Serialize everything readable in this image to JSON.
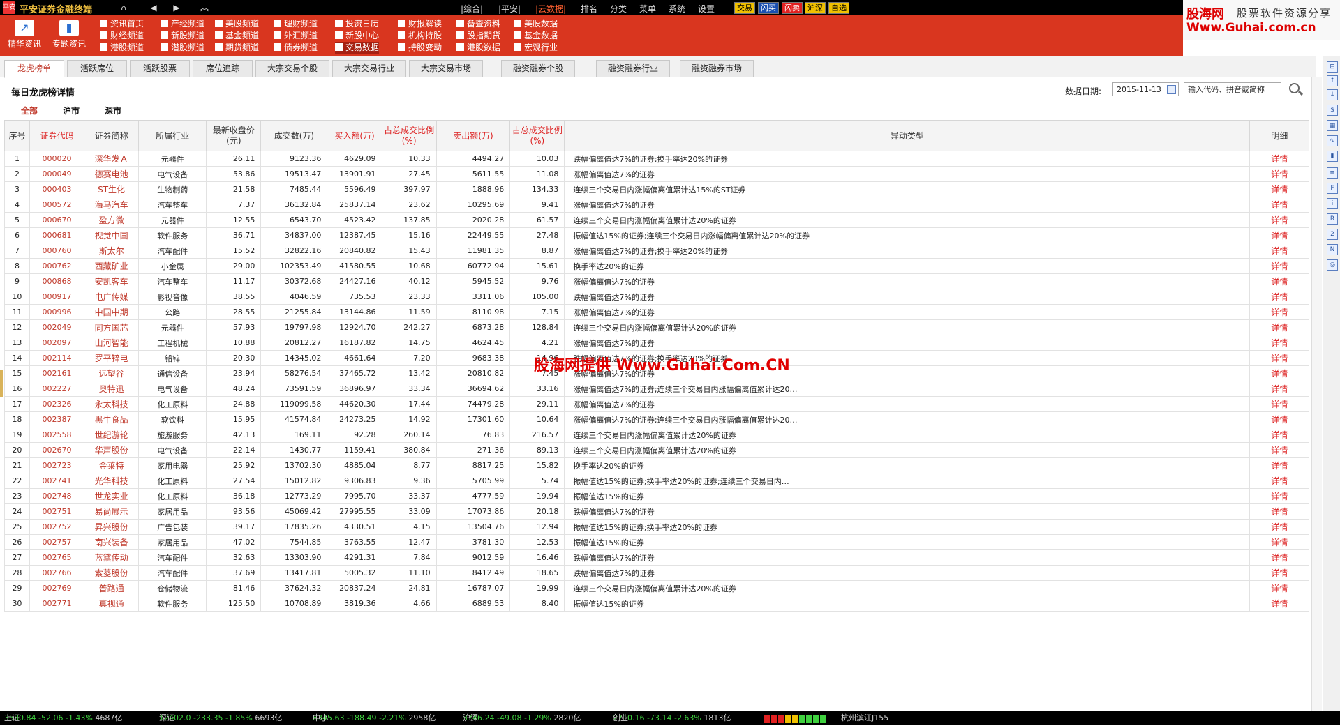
{
  "app": {
    "title": "平安证券金融终端",
    "logo_text": "平安"
  },
  "topbar": {
    "menus": [
      "|综合|",
      "|平安|",
      "|云数据|",
      "排名",
      "分类",
      "菜单",
      "系统",
      "设置"
    ],
    "active_menu": "|云数据|",
    "pills": [
      "交易",
      "闪买",
      "闪卖",
      "沪深",
      "自选"
    ]
  },
  "brand": {
    "line1": "股海网",
    "line2": "股票软件资源分享",
    "line3": "Www.Guhai.com.cn"
  },
  "ribbon": {
    "big_buttons": [
      {
        "label": "精华资讯",
        "icon": "chart-icon"
      },
      {
        "label": "专题资讯",
        "icon": "bar-chart-icon"
      }
    ],
    "columns": [
      [
        "资讯首页",
        "财经频道",
        "港股频道"
      ],
      [
        "产经频道",
        "新股频道",
        "潜股频道"
      ],
      [
        "美股频道",
        "基金频道",
        "期货频道"
      ],
      [
        "理财频道",
        "外汇频道",
        "债券频道"
      ],
      [
        "投资日历",
        "新股中心",
        "交易数据"
      ],
      [
        "财报解读",
        "机构持股",
        "持股变动"
      ],
      [
        "备查资料",
        "股指期货",
        "港股数据"
      ],
      [
        "美股数据",
        "基金数据",
        "宏观行业"
      ]
    ],
    "selected_item": "交易数据"
  },
  "tabs": [
    "龙虎榜单",
    "活跃席位",
    "活跃股票",
    "席位追踪",
    "大宗交易个股",
    "大宗交易行业",
    "大宗交易市场",
    "融资融券个股",
    "融资融券行业",
    "融资融券市场"
  ],
  "active_tab": "龙虎榜单",
  "page": {
    "title": "每日龙虎榜详情",
    "date_label": "数据日期:",
    "date_value": "2015-11-13",
    "search_placeholder": "输入代码、拼音或简称",
    "markets": [
      "全部",
      "沪市",
      "深市"
    ],
    "active_market": "全部"
  },
  "table": {
    "headers": [
      "序号",
      "证券代码",
      "证券简称",
      "所属行业",
      "最新收盘价(元)",
      "成交数(万)",
      "买入额(万)",
      "占总成交比例(%)",
      "卖出额(万)",
      "占总成交比例(%)",
      "异动类型",
      "明细"
    ],
    "red_headers": [
      1,
      6,
      7,
      8,
      9
    ],
    "detail_label": "详情",
    "rows": [
      [
        "1",
        "000020",
        "深华发Ａ",
        "元器件",
        "26.11",
        "9123.36",
        "4629.09",
        "10.33",
        "4494.27",
        "10.03",
        "跌幅偏离值达7%的证券;换手率达20%的证券"
      ],
      [
        "2",
        "000049",
        "德赛电池",
        "电气设备",
        "53.86",
        "19513.47",
        "13901.91",
        "27.45",
        "5611.55",
        "11.08",
        "涨幅偏离值达7%的证券"
      ],
      [
        "3",
        "000403",
        "ST生化",
        "生物制药",
        "21.58",
        "7485.44",
        "5596.49",
        "397.97",
        "1888.96",
        "134.33",
        "连续三个交易日内涨幅偏离值累计达15%的ST证券"
      ],
      [
        "4",
        "000572",
        "海马汽车",
        "汽车整车",
        "7.37",
        "36132.84",
        "25837.14",
        "23.62",
        "10295.69",
        "9.41",
        "涨幅偏离值达7%的证券"
      ],
      [
        "5",
        "000670",
        "盈方微",
        "元器件",
        "12.55",
        "6543.70",
        "4523.42",
        "137.85",
        "2020.28",
        "61.57",
        "连续三个交易日内涨幅偏离值累计达20%的证券"
      ],
      [
        "6",
        "000681",
        "视觉中国",
        "软件服务",
        "36.71",
        "34837.00",
        "12387.45",
        "15.16",
        "22449.55",
        "27.48",
        "振幅值达15%的证券;连续三个交易日内涨幅偏离值累计达20%的证券"
      ],
      [
        "7",
        "000760",
        "斯太尔",
        "汽车配件",
        "15.52",
        "32822.16",
        "20840.82",
        "15.43",
        "11981.35",
        "8.87",
        "涨幅偏离值达7%的证券;换手率达20%的证券"
      ],
      [
        "8",
        "000762",
        "西藏矿业",
        "小金属",
        "29.00",
        "102353.49",
        "41580.55",
        "10.68",
        "60772.94",
        "15.61",
        "换手率达20%的证券"
      ],
      [
        "9",
        "000868",
        "安凯客车",
        "汽车整车",
        "11.17",
        "30372.68",
        "24427.16",
        "40.12",
        "5945.52",
        "9.76",
        "涨幅偏离值达7%的证券"
      ],
      [
        "10",
        "000917",
        "电广传媒",
        "影视音像",
        "38.55",
        "4046.59",
        "735.53",
        "23.33",
        "3311.06",
        "105.00",
        "跌幅偏离值达7%的证券"
      ],
      [
        "11",
        "000996",
        "中国中期",
        "公路",
        "28.55",
        "21255.84",
        "13144.86",
        "11.59",
        "8110.98",
        "7.15",
        "涨幅偏离值达7%的证券"
      ],
      [
        "12",
        "002049",
        "同方国芯",
        "元器件",
        "57.93",
        "19797.98",
        "12924.70",
        "242.27",
        "6873.28",
        "128.84",
        "连续三个交易日内涨幅偏离值累计达20%的证券"
      ],
      [
        "13",
        "002097",
        "山河智能",
        "工程机械",
        "10.88",
        "20812.27",
        "16187.82",
        "14.75",
        "4624.45",
        "4.21",
        "涨幅偏离值达7%的证券"
      ],
      [
        "14",
        "002114",
        "罗平锌电",
        "铅锌",
        "20.30",
        "14345.02",
        "4661.64",
        "7.20",
        "9683.38",
        "14.96",
        "跌幅偏离值达7%的证券;换手率达20%的证券"
      ],
      [
        "15",
        "002161",
        "远望谷",
        "通信设备",
        "23.94",
        "58276.54",
        "37465.72",
        "13.42",
        "20810.82",
        "7.45",
        "涨幅偏离值达7%的证券"
      ],
      [
        "16",
        "002227",
        "奥特迅",
        "电气设备",
        "48.24",
        "73591.59",
        "36896.97",
        "33.34",
        "36694.62",
        "33.16",
        "涨幅偏离值达7%的证券;连续三个交易日内涨幅偏离值累计达20…"
      ],
      [
        "17",
        "002326",
        "永太科技",
        "化工原料",
        "24.88",
        "119099.58",
        "44620.30",
        "17.44",
        "74479.28",
        "29.11",
        "涨幅偏离值达7%的证券"
      ],
      [
        "18",
        "002387",
        "黑牛食品",
        "软饮料",
        "15.95",
        "41574.84",
        "24273.25",
        "14.92",
        "17301.60",
        "10.64",
        "涨幅偏离值达7%的证券;连续三个交易日内涨幅偏离值累计达20…"
      ],
      [
        "19",
        "002558",
        "世纪游轮",
        "旅游服务",
        "42.13",
        "169.11",
        "92.28",
        "260.14",
        "76.83",
        "216.57",
        "连续三个交易日内涨幅偏离值累计达20%的证券"
      ],
      [
        "20",
        "002670",
        "华声股份",
        "电气设备",
        "22.14",
        "1430.77",
        "1159.41",
        "380.84",
        "271.36",
        "89.13",
        "连续三个交易日内涨幅偏离值累计达20%的证券"
      ],
      [
        "21",
        "002723",
        "金莱特",
        "家用电器",
        "25.92",
        "13702.30",
        "4885.04",
        "8.77",
        "8817.25",
        "15.82",
        "换手率达20%的证券"
      ],
      [
        "22",
        "002741",
        "光华科技",
        "化工原料",
        "27.54",
        "15012.82",
        "9306.83",
        "9.36",
        "5705.99",
        "5.74",
        "振幅值达15%的证券;换手率达20%的证券;连续三个交易日内…"
      ],
      [
        "23",
        "002748",
        "世龙实业",
        "化工原料",
        "36.18",
        "12773.29",
        "7995.70",
        "33.37",
        "4777.59",
        "19.94",
        "振幅值达15%的证券"
      ],
      [
        "24",
        "002751",
        "易尚展示",
        "家居用品",
        "93.56",
        "45069.42",
        "27995.55",
        "33.09",
        "17073.86",
        "20.18",
        "跌幅偏离值达7%的证券"
      ],
      [
        "25",
        "002752",
        "昇兴股份",
        "广告包装",
        "39.17",
        "17835.26",
        "4330.51",
        "4.15",
        "13504.76",
        "12.94",
        "振幅值达15%的证券;换手率达20%的证券"
      ],
      [
        "26",
        "002757",
        "南兴装备",
        "家居用品",
        "47.02",
        "7544.85",
        "3763.55",
        "12.47",
        "3781.30",
        "12.53",
        "振幅值达15%的证券"
      ],
      [
        "27",
        "002765",
        "蓝黛传动",
        "汽车配件",
        "32.63",
        "13303.90",
        "4291.31",
        "7.84",
        "9012.59",
        "16.46",
        "跌幅偏离值达7%的证券"
      ],
      [
        "28",
        "002766",
        "索菱股份",
        "汽车配件",
        "37.69",
        "13417.81",
        "5005.32",
        "11.10",
        "8412.49",
        "18.65",
        "跌幅偏离值达7%的证券"
      ],
      [
        "29",
        "002769",
        "普路通",
        "仓储物流",
        "81.46",
        "37624.32",
        "20837.24",
        "24.81",
        "16787.07",
        "19.99",
        "连续三个交易日内涨幅偏离值累计达20%的证券"
      ],
      [
        "30",
        "002771",
        "真视通",
        "软件服务",
        "125.50",
        "10708.89",
        "3819.36",
        "4.66",
        "6889.53",
        "8.40",
        "振幅值达15%的证券"
      ]
    ]
  },
  "watermark": "股海网提供 Www.Guhai.Com.CN",
  "statusbar": {
    "items": [
      {
        "label": "上证",
        "value": "3580.84",
        "change": "-52.06",
        "pct": "-1.43%",
        "amount": "4687亿"
      },
      {
        "label": "深证",
        "value": "12402.0",
        "change": "-233.35",
        "pct": "-1.85%",
        "amount": "6693亿"
      },
      {
        "label": "中小",
        "value": "8345.63",
        "change": "-188.49",
        "pct": "-2.21%",
        "amount": "2958亿"
      },
      {
        "label": "沪深",
        "value": "3746.24",
        "change": "-49.08",
        "pct": "-1.29%",
        "amount": "2820亿"
      },
      {
        "label": "创业",
        "value": "2710.16",
        "change": "-73.14",
        "pct": "-2.63%",
        "amount": "1813亿"
      }
    ],
    "location": "杭州滨江J155"
  },
  "colors": {
    "ribbon": "#d9361f",
    "accent_red": "#c0392b",
    "up": "#ff4040",
    "down": "#3fd13f"
  }
}
